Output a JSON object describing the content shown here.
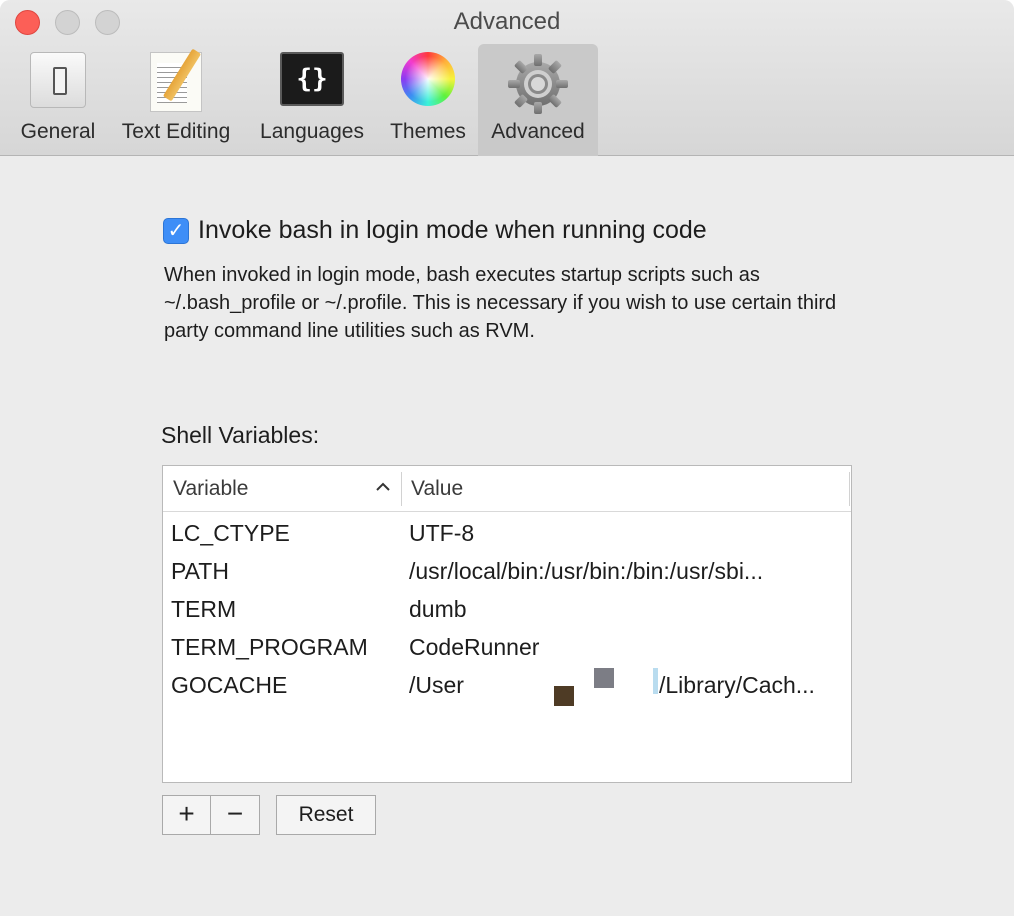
{
  "window": {
    "title": "Advanced"
  },
  "toolbar": {
    "items": [
      {
        "label": "General",
        "icon": "general-icon"
      },
      {
        "label": "Text Editing",
        "icon": "text-editing-icon"
      },
      {
        "label": "Languages",
        "icon": "languages-icon",
        "glyph": "{}"
      },
      {
        "label": "Themes",
        "icon": "color-wheel-icon"
      },
      {
        "label": "Advanced",
        "icon": "gear-icon",
        "selected": true
      }
    ]
  },
  "advanced": {
    "login_mode_checked": true,
    "login_mode_label": "Invoke bash in login mode when running code",
    "login_mode_description": "When invoked in login mode, bash executes startup scripts such as ~/.bash_profile or ~/.profile. This is necessary if you wish to use certain third party command line utilities such as RVM.",
    "shell_variables_label": "Shell Variables:",
    "table": {
      "columns": [
        "Variable",
        "Value"
      ],
      "sort_column": "Variable",
      "sort_direction": "ascending",
      "rows": [
        {
          "variable": "LC_CTYPE",
          "value": "UTF-8"
        },
        {
          "variable": "PATH",
          "value": "/usr/local/bin:/usr/bin:/bin:/usr/sbi..."
        },
        {
          "variable": "TERM",
          "value": "dumb"
        },
        {
          "variable": "TERM_PROGRAM",
          "value": "CodeRunner"
        },
        {
          "variable": "GOCACHE",
          "value_prefix": "/User",
          "value_suffix": "/Library/Cach..."
        }
      ]
    },
    "buttons": {
      "add": "+",
      "remove": "−",
      "reset": "Reset"
    }
  },
  "colors": {
    "accent": "#3e8ef7",
    "close_button": "#fc5f57",
    "window_background": "#ececec"
  }
}
